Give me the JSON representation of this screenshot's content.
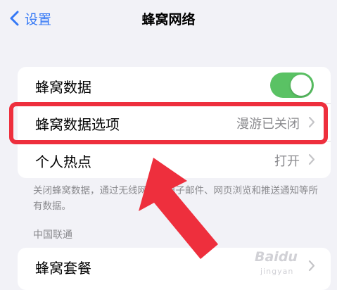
{
  "nav": {
    "back_label": "设置",
    "title": "蜂窝网络"
  },
  "cellular_card": {
    "data_row": {
      "label": "蜂窝数据",
      "toggle_on": true
    },
    "options_row": {
      "label": "蜂窝数据选项",
      "value": "漫游已关闭"
    },
    "hotspot_row": {
      "label": "个人热点",
      "value": "打开"
    }
  },
  "footer_note": "关闭蜂窝数据，通过无线网使用电子邮件、网页浏览和推送通知等所有数据。",
  "section_header": "中国联通",
  "plan_row": {
    "label": "蜂窝套餐"
  },
  "watermark": {
    "text": "Baidu",
    "sub": "jingyan"
  },
  "colors": {
    "accent": "#3478f6",
    "toggle_on": "#5ac264",
    "annotation_red": "#ee2f3d",
    "secondary_text": "#8a8a8e",
    "background": "#f2f2f7"
  },
  "icons": [
    "chevron-left-icon",
    "chevron-right-icon",
    "toggle-switch",
    "annotation-arrow"
  ]
}
